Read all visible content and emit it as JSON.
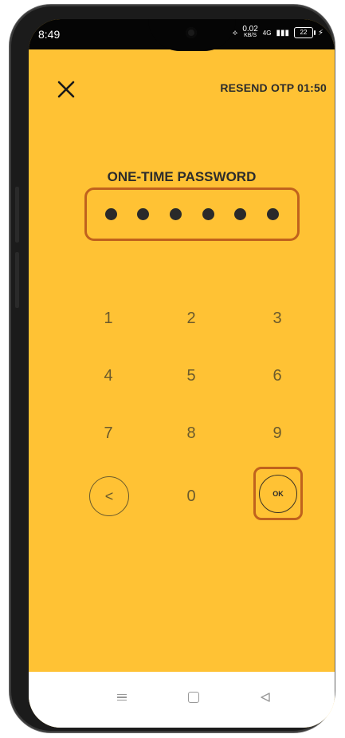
{
  "status_bar": {
    "time": "8:49",
    "net_speed": "0.02",
    "net_unit": "KB/S",
    "signal": "4G",
    "battery": "22"
  },
  "header": {
    "close_icon": "close-icon",
    "resend_label": "RESEND OTP 01:50"
  },
  "otp": {
    "title": "ONE-TIME PASSWORD",
    "digits_entered": 6
  },
  "keypad": {
    "keys": [
      "1",
      "2",
      "3",
      "4",
      "5",
      "6",
      "7",
      "8",
      "9",
      "0"
    ],
    "back_icon": "chevron-left-icon",
    "ok_label": "OK"
  },
  "colors": {
    "background": "#FFC234",
    "highlight_border": "#C0621D"
  }
}
